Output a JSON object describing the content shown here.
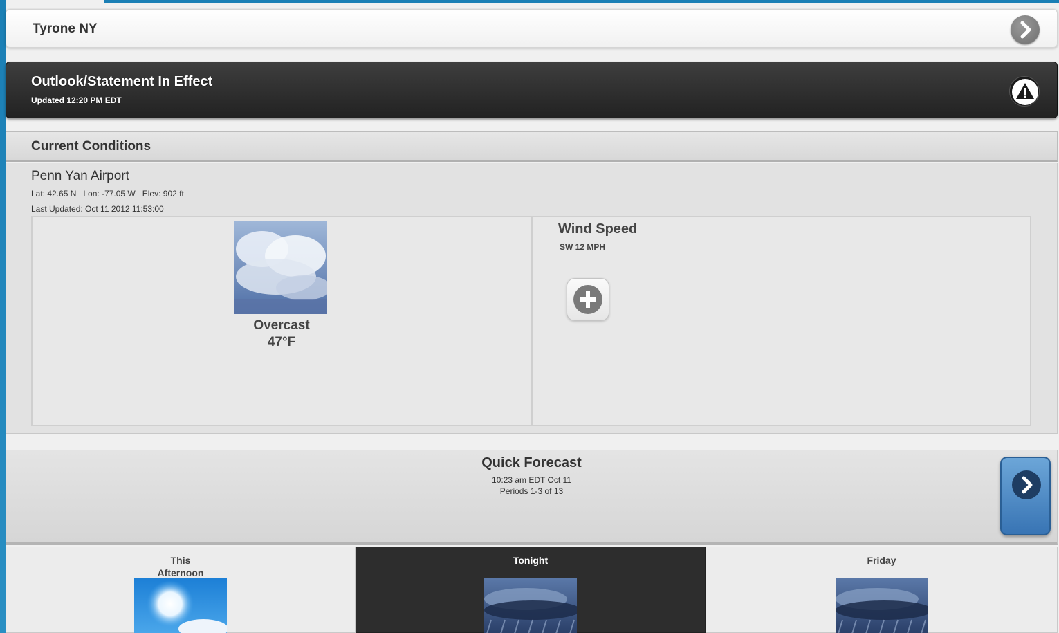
{
  "location": {
    "name": "Tyrone NY",
    "go_icon": "chevron-right-icon"
  },
  "alert": {
    "title": "Outlook/Statement In Effect",
    "updated": "Updated 12:20 PM EDT",
    "icon": "warning-icon"
  },
  "current_conditions": {
    "header": "Current Conditions",
    "station": "Penn Yan Airport",
    "coords": "Lat: 42.65 N   Lon: -77.05 W   Elev: 902 ft",
    "last_updated": "Last Updated: Oct 11 2012 11:53:00",
    "condition": "Overcast",
    "temperature": "47°F",
    "condition_icon": "overcast-clouds-image",
    "wind": {
      "label": "Wind Speed",
      "value": "SW 12 MPH"
    },
    "more_icon": "plus-icon"
  },
  "quick_forecast": {
    "title": "Quick Forecast",
    "time": "10:23 am EDT Oct 11",
    "periods_label": "Periods 1-3 of 13",
    "next_icon": "chevron-right-icon",
    "periods": [
      {
        "name_line1": "This",
        "name_line2": "Afternoon",
        "icon": "sunny-image"
      },
      {
        "name_line1": "Tonight",
        "name_line2": "",
        "icon": "rain-image"
      },
      {
        "name_line1": "Friday",
        "name_line2": "",
        "icon": "rain-image"
      }
    ]
  },
  "colors": {
    "accent_blue": "#1b7fb5",
    "alert_bg": "#2b2b2b",
    "selected_period": "#2d2d2d"
  }
}
